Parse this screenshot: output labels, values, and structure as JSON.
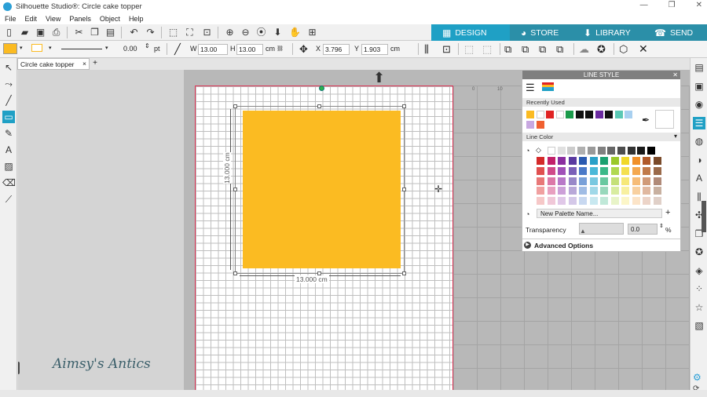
{
  "window": {
    "title": "Silhouette Studio®: Circle cake topper",
    "controls": [
      "—",
      "❐",
      "✕"
    ]
  },
  "menu": [
    "File",
    "Edit",
    "View",
    "Panels",
    "Object",
    "Help"
  ],
  "nav_tabs": [
    {
      "label": "DESIGN",
      "icon": "grid-icon",
      "glyph": "▦",
      "color": "#1fa0c5"
    },
    {
      "label": "STORE",
      "icon": "store-icon",
      "glyph": "◕",
      "color": "#2b8fa8"
    },
    {
      "label": "LIBRARY",
      "icon": "library-icon",
      "glyph": "⬇",
      "color": "#2b8fa8"
    },
    {
      "label": "SEND",
      "icon": "send-icon",
      "glyph": "☎",
      "color": "#2b8fa8"
    }
  ],
  "toolbar2": {
    "fill_color": "#fbbb22",
    "line_width": "0.00",
    "line_unit": "pt",
    "w_label": "W",
    "w_value": "13.00",
    "h_label": "H",
    "h_value": "13.00",
    "size_unit": "cm",
    "x_label": "X",
    "x_value": "3.796",
    "y_label": "Y",
    "y_value": "1.903"
  },
  "doc_tab": {
    "label": "Circle cake topper",
    "close": "×",
    "add": "+"
  },
  "canvas": {
    "width_dimension": "13.000 cm",
    "height_dimension": "13.000 cm",
    "watermark": "Aimsy's Antics",
    "shape_color": "#fbbb22",
    "ruler_marks": [
      "0",
      "10"
    ]
  },
  "panel": {
    "title": "LINE STYLE",
    "recently_used_label": "Recently Used",
    "line_color_label": "Line Color",
    "new_palette_placeholder": "New Palette Name...",
    "transparency_label": "Transparency",
    "transparency_value": "0.0",
    "transparency_unit": "%",
    "advanced_label": "Advanced Options",
    "recent_colors": [
      "#fbbb22",
      "#ffffff",
      "#e02424",
      "#ffffff",
      "#1a9a4a",
      "#111111",
      "#111111",
      "#6a2aa0",
      "#111111",
      "#5ac8b4",
      "#a8d0f0",
      "#c8a8e0",
      "#f06030"
    ],
    "palette_row1": [
      "#ffffff",
      "#e0e0e0",
      "#cccccc",
      "#b0b0b0",
      "#999999",
      "#808080",
      "#666666",
      "#4d4d4d",
      "#333333",
      "#1a1a1a",
      "#000000"
    ],
    "palette_rows": [
      [
        "#d42a2a",
        "#c2206a",
        "#8a2ea0",
        "#5a3aa0",
        "#2a5ab0",
        "#2aa0c8",
        "#1aa070",
        "#9ac82a",
        "#f0d82a",
        "#f0902a",
        "#b05a2a",
        "#7a4a2a"
      ],
      [
        "#e05050",
        "#d04a8a",
        "#a050b8",
        "#7a60b8",
        "#4a7ac8",
        "#4ab8d8",
        "#3ab888",
        "#b0d850",
        "#f4e050",
        "#f4a850",
        "#c07a4a",
        "#9a6a4a"
      ],
      [
        "#e87878",
        "#dc78a8",
        "#b878c8",
        "#9888c8",
        "#78a0d8",
        "#78c8e0",
        "#68c8a0",
        "#c4e078",
        "#f6e878",
        "#f6bc78",
        "#d09a78",
        "#b08a78"
      ],
      [
        "#f0a0a0",
        "#e8a0c0",
        "#cca0d8",
        "#b8a8d8",
        "#a0bce4",
        "#a0d8e8",
        "#98d8bc",
        "#d8eca0",
        "#f8f0a0",
        "#f8d0a0",
        "#e0b8a0",
        "#c8b0a0"
      ],
      [
        "#f6c8c8",
        "#f0c8d8",
        "#e0c8e8",
        "#d4c8e8",
        "#c8d8f0",
        "#c8e8f0",
        "#c0e8d8",
        "#e8f4c8",
        "#fcf6c8",
        "#fce4c8",
        "#ecd4c8",
        "#e0d0c8"
      ]
    ]
  },
  "left_tools": [
    {
      "name": "select-tool-icon",
      "glyph": "↖"
    },
    {
      "name": "edit-points-icon",
      "glyph": "⤳"
    },
    {
      "name": "line-tool-icon",
      "glyph": "╱"
    },
    {
      "name": "shape-tool-icon",
      "glyph": "▭"
    },
    {
      "name": "pencil-tool-icon",
      "glyph": "✎"
    },
    {
      "name": "text-tool-icon",
      "glyph": "A"
    },
    {
      "name": "fill-tool-icon",
      "glyph": "▨"
    },
    {
      "name": "eraser-tool-icon",
      "glyph": "⌫"
    },
    {
      "name": "knife-tool-icon",
      "glyph": "⟋"
    }
  ],
  "right_tools": [
    {
      "name": "page-setup-icon",
      "glyph": "▤"
    },
    {
      "name": "pixscan-icon",
      "glyph": "▣"
    },
    {
      "name": "fill-panel-icon",
      "glyph": "◉"
    },
    {
      "name": "line-style-icon",
      "glyph": "☰"
    },
    {
      "name": "stamp-icon",
      "glyph": "◍"
    },
    {
      "name": "contrast-icon",
      "glyph": "◑"
    },
    {
      "name": "font-icon",
      "glyph": "A"
    },
    {
      "name": "align-icon",
      "glyph": "⫼"
    },
    {
      "name": "transform-icon",
      "glyph": "✣"
    },
    {
      "name": "replicate-icon",
      "glyph": "❐"
    },
    {
      "name": "star-icon",
      "glyph": "✪"
    },
    {
      "name": "trace-icon",
      "glyph": "◈"
    },
    {
      "name": "sketch-icon",
      "glyph": "⁘"
    },
    {
      "name": "favorite-star-icon",
      "glyph": "☆"
    },
    {
      "name": "hatch-icon",
      "glyph": "▧"
    }
  ]
}
